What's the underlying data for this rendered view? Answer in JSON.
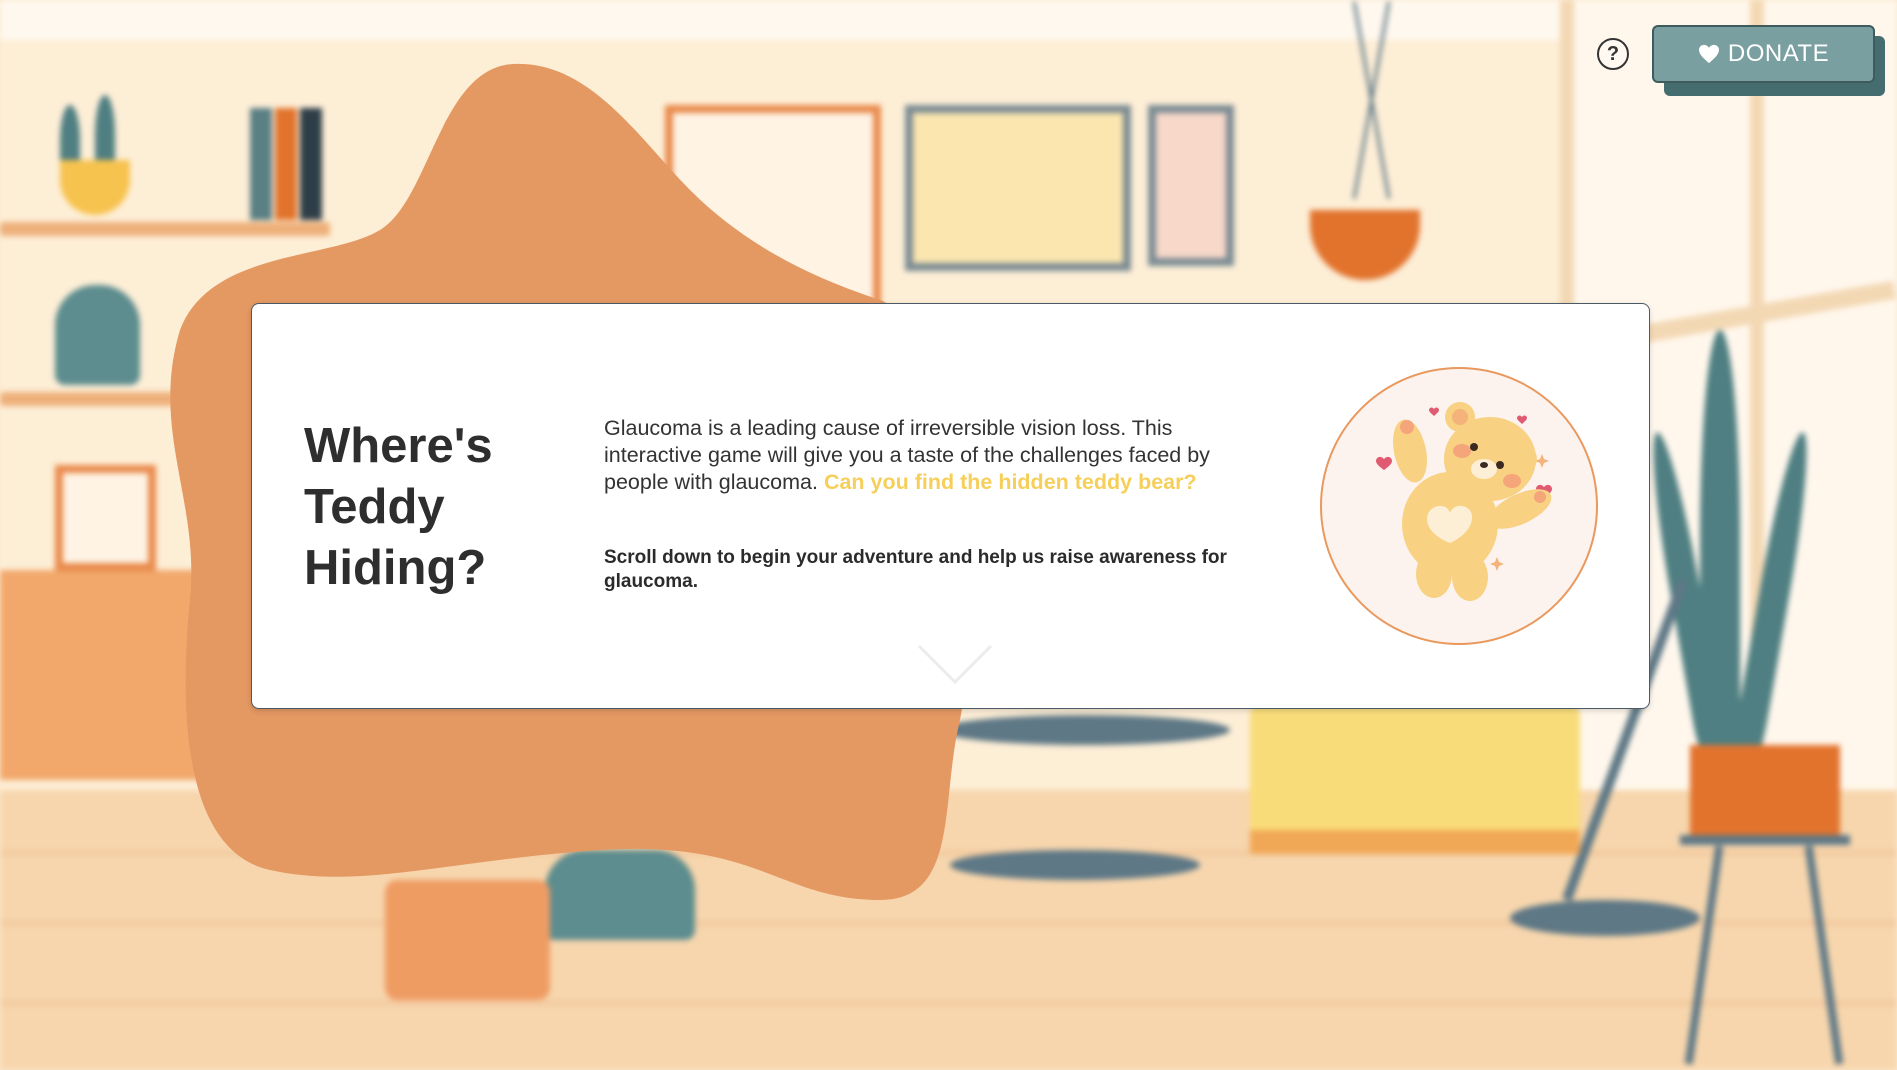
{
  "header": {
    "help_symbol": "?",
    "donate_label": "DONATE"
  },
  "hero": {
    "title": "Where's Teddy Hiding?",
    "description_main": "Glaucoma is a leading cause of irreversible vision loss. This interactive game will give you a taste of the challenges faced by people with glaucoma.",
    "description_highlight": "Can you find the hidden teddy bear?",
    "cta": "Scroll down to begin your adventure and help us raise awareness for glaucoma."
  },
  "icons": {
    "help": "question-circle-icon",
    "donate": "heart-icon",
    "scroll": "chevron-down-icon",
    "mascot": "teddy-bear-illustration"
  },
  "colors": {
    "blob": "#e49862",
    "highlight": "#f6cf5a",
    "donate_bg": "#7a9fa0",
    "donate_shadow": "#456d6f",
    "title": "#2e2e2e"
  }
}
